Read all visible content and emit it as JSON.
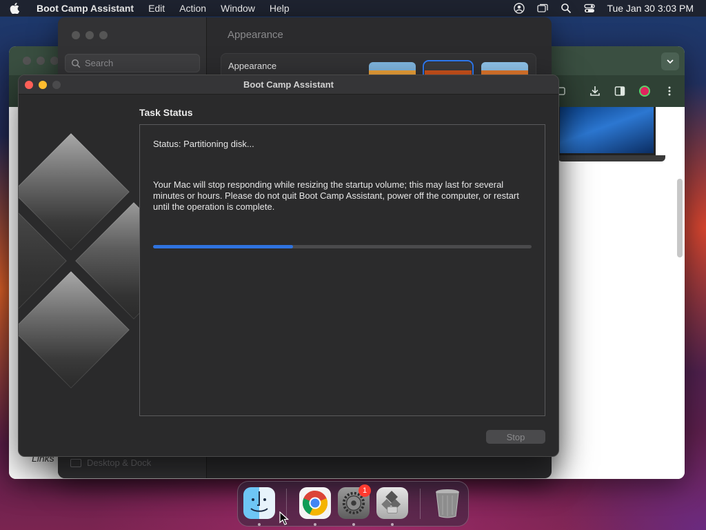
{
  "menubar": {
    "app_name": "Boot Camp Assistant",
    "items": [
      "Edit",
      "Action",
      "Window",
      "Help"
    ],
    "clock": "Tue Jan 30  3:03 PM"
  },
  "settings_window": {
    "search_placeholder": "Search",
    "title": "Appearance",
    "card_label": "Appearance",
    "sidebar_bottom_item": "Desktop & Dock"
  },
  "chrome_window": {
    "links_text": "Links"
  },
  "bootcamp": {
    "window_title": "Boot Camp Assistant",
    "heading": "Task Status",
    "status": "Status: Partitioning disk...",
    "message": "Your Mac will stop responding while resizing the startup volume; this may last for several minutes or hours. Please do not quit Boot Camp Assistant, power off the computer, or restart until the operation is complete.",
    "progress": 0.37,
    "stop_label": "Stop"
  },
  "dock": {
    "apps": [
      "finder-icon",
      "chrome-icon",
      "system-settings-icon",
      "boot-camp-icon",
      "trash-icon"
    ],
    "settings_badge": "1"
  },
  "colors": {
    "accent": "#2f73e0",
    "close": "#ff5f57",
    "minimize": "#febc2e"
  }
}
